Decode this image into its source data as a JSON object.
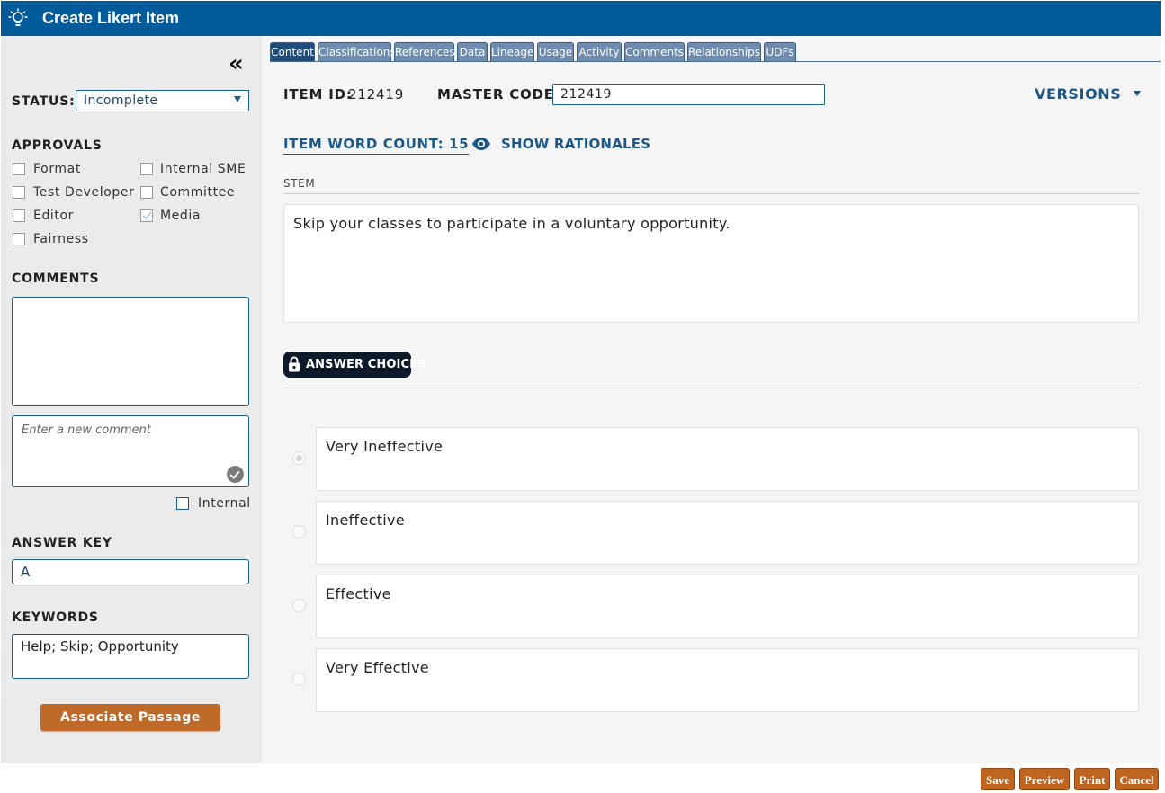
{
  "window": {
    "title": "Create Likert Item",
    "icon": "lightbulb-icon",
    "accent": "#005b9a"
  },
  "sidebar": {
    "collapse_glyph": "«",
    "status": {
      "label": "STATUS:",
      "value": "Incomplete"
    },
    "approvals": {
      "label": "APPROVALS",
      "items": [
        {
          "label": "Format",
          "checked": false
        },
        {
          "label": "Internal SME",
          "checked": false
        },
        {
          "label": "Test Developer",
          "checked": false
        },
        {
          "label": "Committee",
          "checked": false
        },
        {
          "label": "Editor",
          "checked": false
        },
        {
          "label": "Media",
          "checked": true
        },
        {
          "label": "Fairness",
          "checked": false
        }
      ]
    },
    "comments": {
      "label": "COMMENTS",
      "new_placeholder": "Enter a new comment",
      "internal_label": "Internal"
    },
    "answer_key": {
      "label": "ANSWER KEY",
      "value": "A"
    },
    "keywords": {
      "label": "KEYWORDS",
      "value": "Help; Skip; Opportunity"
    },
    "associate_button": "Associate Passage",
    "button_color": "#c06a2a"
  },
  "tabs": [
    {
      "label": "Content",
      "active": true
    },
    {
      "label": "Classifications",
      "active": false
    },
    {
      "label": "References",
      "active": false
    },
    {
      "label": "Data",
      "active": false
    },
    {
      "label": "Lineage",
      "active": false
    },
    {
      "label": "Usage",
      "active": false
    },
    {
      "label": "Activity",
      "active": false
    },
    {
      "label": "Comments",
      "active": false
    },
    {
      "label": "Relationships",
      "active": false
    },
    {
      "label": "UDFs",
      "active": false
    }
  ],
  "content": {
    "item_id_label": "ITEM ID:",
    "item_id": "212419",
    "master_code_label": "MASTER CODE:",
    "master_code": "212419",
    "versions_label": "VERSIONS",
    "word_count_label": "ITEM WORD COUNT: 15",
    "show_rationales_label": "SHOW RATIONALES",
    "stem_label": "STEM",
    "stem_text": "Skip your classes to participate in a voluntary opportunity.",
    "answer_choices_label": "ANSWER CHOICES",
    "choices": [
      {
        "text": "Very Ineffective",
        "selected": true
      },
      {
        "text": "Ineffective",
        "selected": false
      },
      {
        "text": "Effective",
        "selected": false
      },
      {
        "text": "Very Effective",
        "selected": false
      }
    ]
  },
  "footer": {
    "save": "Save",
    "preview": "Preview",
    "print": "Print",
    "cancel": "Cancel"
  }
}
